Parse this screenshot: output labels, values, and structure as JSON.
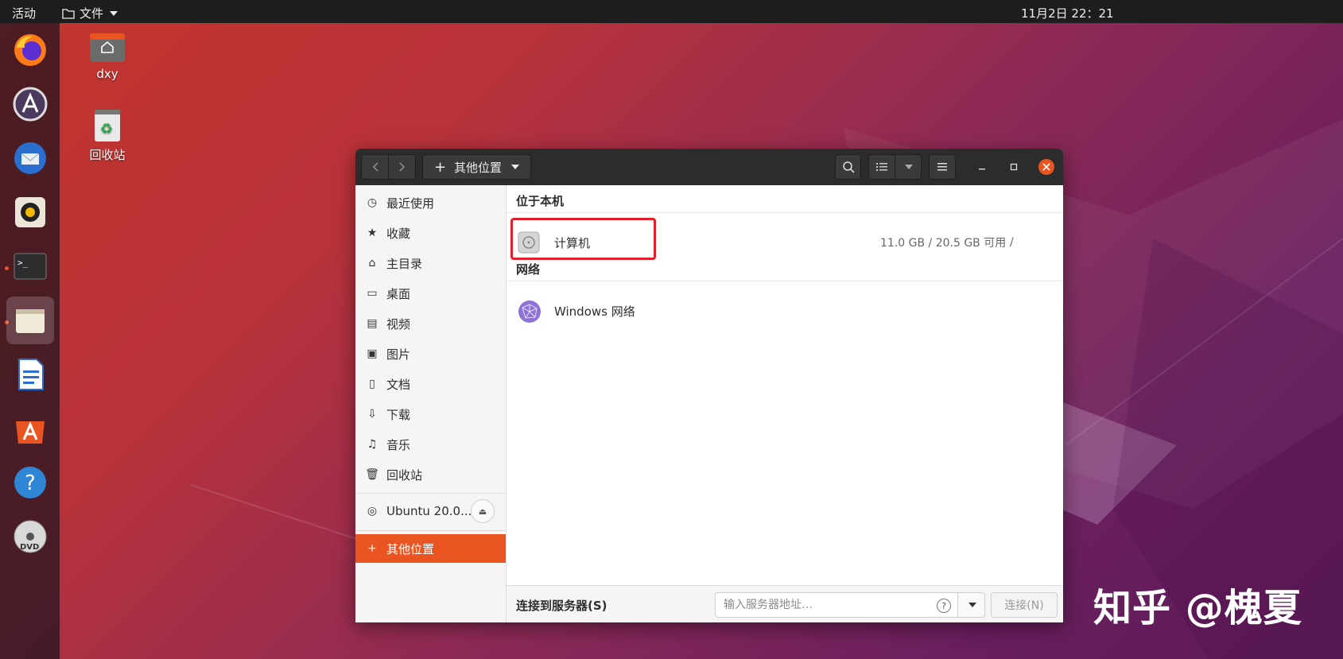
{
  "topbar": {
    "activities": "活动",
    "app_menu": "文件",
    "clock": "11月2日  22：21"
  },
  "dock": {
    "apps": [
      "firefox-icon",
      "software-updater-icon",
      "thunderbird-icon",
      "rhythmbox-icon",
      "terminal-icon",
      "files-icon",
      "libreoffice-writer-icon",
      "ubuntu-software-icon",
      "help-icon",
      "dvd-icon"
    ]
  },
  "desktop": {
    "home_label": "dxy",
    "trash_label": "回收站"
  },
  "window": {
    "path_label": "其他位置",
    "sidebar": {
      "items": [
        {
          "label": "最近使用",
          "icon": "clock-icon"
        },
        {
          "label": "收藏",
          "icon": "star-icon"
        },
        {
          "label": "主目录",
          "icon": "home-icon"
        },
        {
          "label": "桌面",
          "icon": "desktop-icon"
        },
        {
          "label": "视频",
          "icon": "video-icon"
        },
        {
          "label": "图片",
          "icon": "image-icon"
        },
        {
          "label": "文档",
          "icon": "document-icon"
        },
        {
          "label": "下载",
          "icon": "download-icon"
        },
        {
          "label": "音乐",
          "icon": "music-icon"
        },
        {
          "label": "回收站",
          "icon": "trash-icon"
        }
      ],
      "device_label": "Ubuntu 20.0...",
      "other_locations": "其他位置"
    },
    "main": {
      "local_title": "位于本机",
      "computer_label": "计算机",
      "computer_info": "11.0 GB / 20.5 GB 可用",
      "computer_mount": "/",
      "network_title": "网络",
      "windows_network": "Windows 网络"
    },
    "bottom": {
      "connect_label": "连接到服务器(S)",
      "server_placeholder": "输入服务器地址…",
      "connect_button": "连接(N)"
    }
  },
  "watermark": "知乎 @槐夏",
  "colors": {
    "accent": "#e95420",
    "highlight": "#e0202a",
    "header": "#2c2c2c"
  }
}
